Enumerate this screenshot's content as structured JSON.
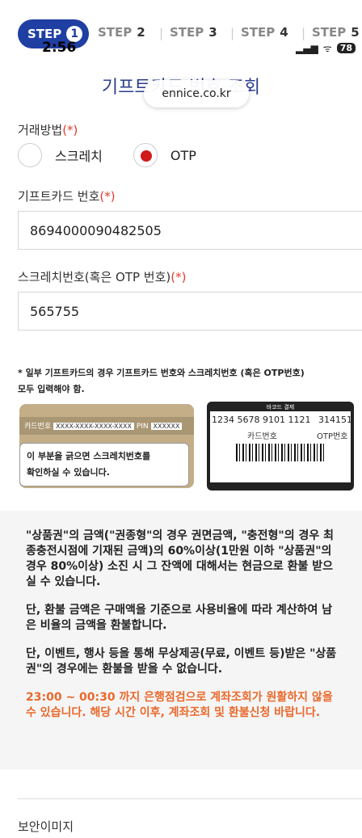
{
  "steps": {
    "prefix": "STEP",
    "items": [
      {
        "num": "1",
        "active": true
      },
      {
        "num": "2"
      },
      {
        "num": "3"
      },
      {
        "num": "4"
      },
      {
        "num": "5"
      }
    ]
  },
  "status_bar": {
    "time": "2:56",
    "signal": "▂▄▆",
    "wifi": "ᯤ",
    "battery": "78"
  },
  "page": {
    "title": "기프트카드 번호 조회",
    "url": "ennice.co.kr"
  },
  "trade_method": {
    "label": "거래방법",
    "required": "(*)",
    "options": [
      {
        "label": "스크레치",
        "checked": false
      },
      {
        "label": "OTP",
        "checked": true
      }
    ]
  },
  "gift_card": {
    "label": "기프트카드 번호",
    "required": "(*)",
    "value": "8694000090482505"
  },
  "scratch": {
    "label": "스크레치번호(혹은 OTP 번호)",
    "required": "(*)",
    "value": "565755"
  },
  "notice": {
    "line1": "* 일부 기프트카드의 경우 기프트카드 번호와 스크레치번호 (혹은 OTP번호)",
    "line2": "모두 입력해야 함."
  },
  "illustration_left": {
    "strip_label": "카드번호",
    "strip_box": "XXXX-XXXX-XXXX-XXXX",
    "pin_label": "PIN",
    "pin_box": "XXXXXX",
    "bubble_line1": "이 부분을 긁으면 스크레치번호를",
    "bubble_line2": "확인하실 수 있습니다."
  },
  "illustration_right": {
    "header": "바코드 결제",
    "card_numbers": "1234  5678  9101  1121",
    "otp_number": "314151",
    "card_label": "카드번호",
    "otp_label": "OTP번호"
  },
  "info": {
    "p1": "\"상품권\"의 금액(\"권종형\"의 경우 권면금액, \"충전형\"의 경우 최종충전시점에 기재된 금액)의 60%이상(1만원 이하 \"상품권\"의 경우 80%이상) 소진 시 그 잔액에 대해서는 현금으로 환불 받으실 수 있습니다.",
    "p2": "단, 환불 금액은 구매액을 기준으로 사용비율에 따라 계산하여 남은 비율의 금액을 환불합니다.",
    "p3": "단, 이벤트, 행사 등을 통해 무상제공(무료, 이벤트 등)받은 \"상품권\"의 경우에는 환불을 받을 수 없습니다.",
    "warning": "23:00 ~ 00:30 까지 은행점검으로 계좌조회가 원활하지 않을 수 있습니다. 해당 시간 이후, 계좌조회 및 환불신청 바랍니다."
  },
  "security": {
    "label": "보안이미지"
  },
  "colors": {
    "accent": "#1f3fa3",
    "required": "#e23a2e",
    "warning": "#e9692c"
  }
}
